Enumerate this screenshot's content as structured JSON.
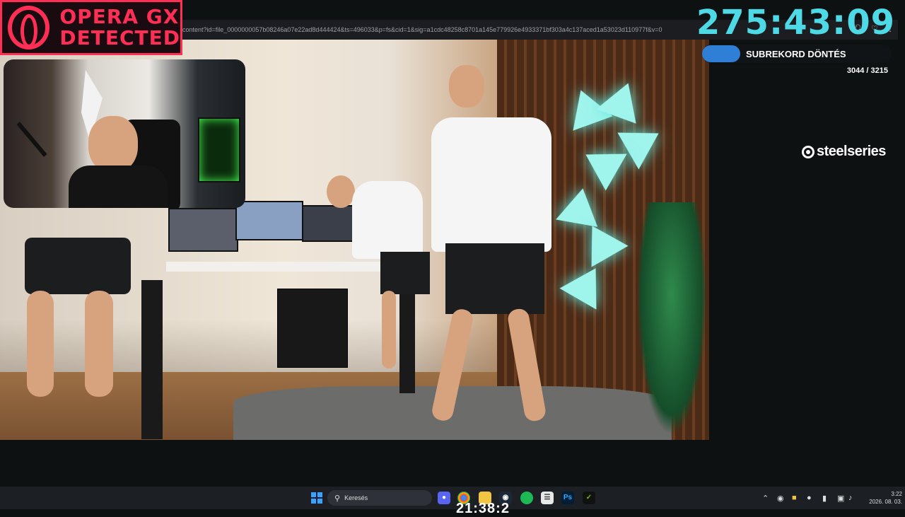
{
  "browser": {
    "url": "content?id=file_0000000057b08246a07e22ad8d444424&ts=496033&p=fs&cid=1&sig=a1cdc48258c8701a145e779926e4933371bf303a4c137aced1a53023d110977f&v=0"
  },
  "overlay": {
    "opera_line1": "OPERA GX",
    "opera_line2": "DETECTED",
    "timer": "275:43:09",
    "subrekord_label": "SUBREKORD DÖNTÉS",
    "subrekord_count": "3044 / 3215",
    "sponsor": "steelseries",
    "bottom_numbers": "21:38:2"
  },
  "taskbar": {
    "search_placeholder": "Keresés",
    "time": "3:22",
    "date": "2026. 08. 03.",
    "apps": [
      "discord-icon",
      "chrome-icon",
      "file-explorer-icon",
      "steam-icon",
      "spotify-icon",
      "notepad-icon",
      "photoshop-icon",
      "nvidia-icon"
    ],
    "photoshop_label": "Ps"
  },
  "colors": {
    "accent_red": "#ff2e55",
    "timer_cyan": "#4ed9e6",
    "progress_blue": "#2f7fd6"
  }
}
